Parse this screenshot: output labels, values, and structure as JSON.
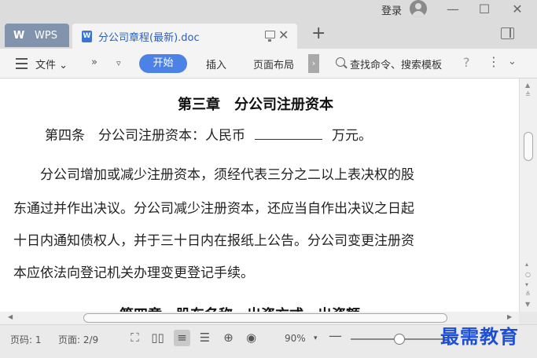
{
  "window": {
    "login_label": "登录",
    "min_glyph": "—",
    "max_glyph": "☐",
    "close_glyph": "✕"
  },
  "tabs": {
    "home_logo": "W",
    "home_label": "WPS",
    "document_icon": "W",
    "document_title": "分公司章程(最新).doc",
    "close_glyph": "✕",
    "new_tab_glyph": "+"
  },
  "ribbon": {
    "file_menu": "文件 ⌄",
    "more_tabs": "»",
    "quick_dropdown": "▿",
    "tabs": [
      "开始",
      "插入",
      "页面布局"
    ],
    "scroll_glyph": "›",
    "search_placeholder": "查找命令、搜索模板",
    "help_glyph": "?",
    "more_glyph": "⋮",
    "collapse_glyph": "⌄"
  },
  "document": {
    "heading": "第三章　分公司注册资本",
    "article_prefix": "第四条　分公司注册资本：人民币",
    "article_suffix": "万元。",
    "paragraph_lines": [
      "　　分公司增加或减少注册资本，须经代表三分之二以上表决权的股",
      "东通过并作出决议。分公司减少注册资本，还应当自作出决议之日起",
      "十日内通知债权人，并于三十日内在报纸上公告。分公司变更注册资",
      "本应依法向登记机关办理变更登记手续。"
    ],
    "next_heading": "第四章　股东名称、出资方式、出资额"
  },
  "status": {
    "page": "页码: 1",
    "pages": "页面: 2/9",
    "zoom": "90%",
    "zoom_dropdown": "▾",
    "zoom_out": "—",
    "zoom_fraction": 0.52,
    "watermark": "最需教育"
  },
  "icons": {
    "fullscreen": "⛶",
    "reading": "▯▯",
    "page_view": "≡",
    "outline": "☰",
    "web": "⊕",
    "eye": "◉"
  },
  "colors": {
    "accent": "#4c82e6",
    "watermark": "#1c4fd6"
  }
}
